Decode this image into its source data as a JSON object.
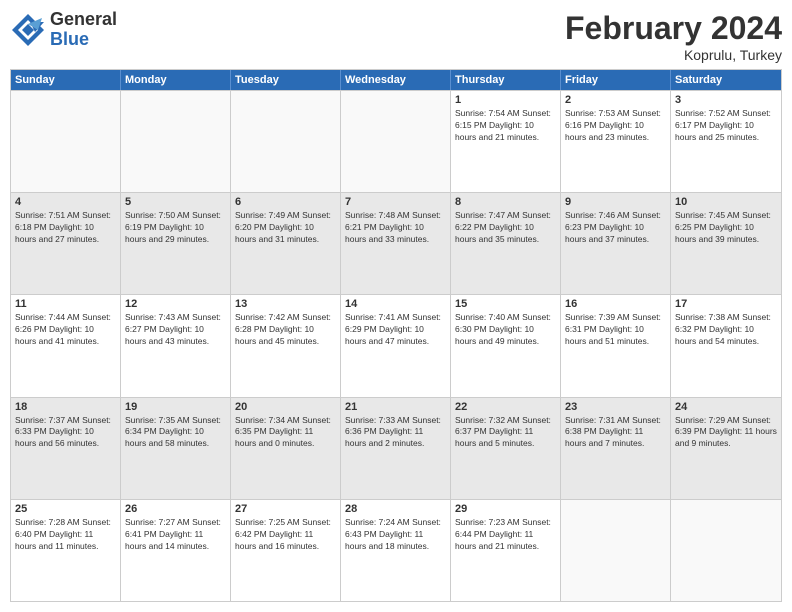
{
  "logo": {
    "general": "General",
    "blue": "Blue"
  },
  "title": "February 2024",
  "location": "Koprulu, Turkey",
  "days": [
    "Sunday",
    "Monday",
    "Tuesday",
    "Wednesday",
    "Thursday",
    "Friday",
    "Saturday"
  ],
  "rows": [
    [
      {
        "day": "",
        "info": ""
      },
      {
        "day": "",
        "info": ""
      },
      {
        "day": "",
        "info": ""
      },
      {
        "day": "",
        "info": ""
      },
      {
        "day": "1",
        "info": "Sunrise: 7:54 AM\nSunset: 6:15 PM\nDaylight: 10 hours and 21 minutes."
      },
      {
        "day": "2",
        "info": "Sunrise: 7:53 AM\nSunset: 6:16 PM\nDaylight: 10 hours and 23 minutes."
      },
      {
        "day": "3",
        "info": "Sunrise: 7:52 AM\nSunset: 6:17 PM\nDaylight: 10 hours and 25 minutes."
      }
    ],
    [
      {
        "day": "4",
        "info": "Sunrise: 7:51 AM\nSunset: 6:18 PM\nDaylight: 10 hours and 27 minutes."
      },
      {
        "day": "5",
        "info": "Sunrise: 7:50 AM\nSunset: 6:19 PM\nDaylight: 10 hours and 29 minutes."
      },
      {
        "day": "6",
        "info": "Sunrise: 7:49 AM\nSunset: 6:20 PM\nDaylight: 10 hours and 31 minutes."
      },
      {
        "day": "7",
        "info": "Sunrise: 7:48 AM\nSunset: 6:21 PM\nDaylight: 10 hours and 33 minutes."
      },
      {
        "day": "8",
        "info": "Sunrise: 7:47 AM\nSunset: 6:22 PM\nDaylight: 10 hours and 35 minutes."
      },
      {
        "day": "9",
        "info": "Sunrise: 7:46 AM\nSunset: 6:23 PM\nDaylight: 10 hours and 37 minutes."
      },
      {
        "day": "10",
        "info": "Sunrise: 7:45 AM\nSunset: 6:25 PM\nDaylight: 10 hours and 39 minutes."
      }
    ],
    [
      {
        "day": "11",
        "info": "Sunrise: 7:44 AM\nSunset: 6:26 PM\nDaylight: 10 hours and 41 minutes."
      },
      {
        "day": "12",
        "info": "Sunrise: 7:43 AM\nSunset: 6:27 PM\nDaylight: 10 hours and 43 minutes."
      },
      {
        "day": "13",
        "info": "Sunrise: 7:42 AM\nSunset: 6:28 PM\nDaylight: 10 hours and 45 minutes."
      },
      {
        "day": "14",
        "info": "Sunrise: 7:41 AM\nSunset: 6:29 PM\nDaylight: 10 hours and 47 minutes."
      },
      {
        "day": "15",
        "info": "Sunrise: 7:40 AM\nSunset: 6:30 PM\nDaylight: 10 hours and 49 minutes."
      },
      {
        "day": "16",
        "info": "Sunrise: 7:39 AM\nSunset: 6:31 PM\nDaylight: 10 hours and 51 minutes."
      },
      {
        "day": "17",
        "info": "Sunrise: 7:38 AM\nSunset: 6:32 PM\nDaylight: 10 hours and 54 minutes."
      }
    ],
    [
      {
        "day": "18",
        "info": "Sunrise: 7:37 AM\nSunset: 6:33 PM\nDaylight: 10 hours and 56 minutes."
      },
      {
        "day": "19",
        "info": "Sunrise: 7:35 AM\nSunset: 6:34 PM\nDaylight: 10 hours and 58 minutes."
      },
      {
        "day": "20",
        "info": "Sunrise: 7:34 AM\nSunset: 6:35 PM\nDaylight: 11 hours and 0 minutes."
      },
      {
        "day": "21",
        "info": "Sunrise: 7:33 AM\nSunset: 6:36 PM\nDaylight: 11 hours and 2 minutes."
      },
      {
        "day": "22",
        "info": "Sunrise: 7:32 AM\nSunset: 6:37 PM\nDaylight: 11 hours and 5 minutes."
      },
      {
        "day": "23",
        "info": "Sunrise: 7:31 AM\nSunset: 6:38 PM\nDaylight: 11 hours and 7 minutes."
      },
      {
        "day": "24",
        "info": "Sunrise: 7:29 AM\nSunset: 6:39 PM\nDaylight: 11 hours and 9 minutes."
      }
    ],
    [
      {
        "day": "25",
        "info": "Sunrise: 7:28 AM\nSunset: 6:40 PM\nDaylight: 11 hours and 11 minutes."
      },
      {
        "day": "26",
        "info": "Sunrise: 7:27 AM\nSunset: 6:41 PM\nDaylight: 11 hours and 14 minutes."
      },
      {
        "day": "27",
        "info": "Sunrise: 7:25 AM\nSunset: 6:42 PM\nDaylight: 11 hours and 16 minutes."
      },
      {
        "day": "28",
        "info": "Sunrise: 7:24 AM\nSunset: 6:43 PM\nDaylight: 11 hours and 18 minutes."
      },
      {
        "day": "29",
        "info": "Sunrise: 7:23 AM\nSunset: 6:44 PM\nDaylight: 11 hours and 21 minutes."
      },
      {
        "day": "",
        "info": ""
      },
      {
        "day": "",
        "info": ""
      }
    ]
  ]
}
